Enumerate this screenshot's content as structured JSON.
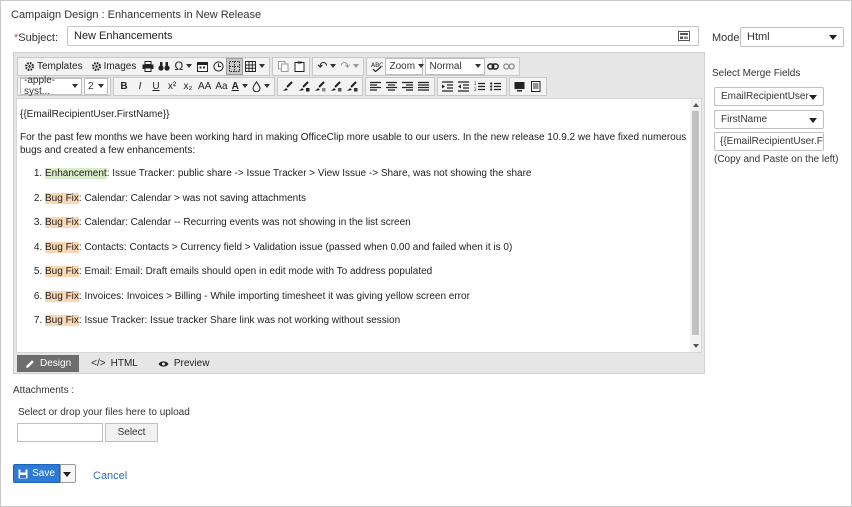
{
  "page": {
    "title": "Campaign Design : Enhancements in New Release"
  },
  "subject": {
    "required_mark": "*",
    "label": "Subject:",
    "value": "New Enhancements"
  },
  "mode": {
    "label": "Mode:",
    "value": "Html"
  },
  "toolbar": {
    "templates": "Templates",
    "images": "Images",
    "zoom": "Zoom",
    "format": "Normal",
    "font": "-apple-syst...",
    "size": "2",
    "bold": "B",
    "italic": "I",
    "underline": "U",
    "superscript": "x²",
    "subscript": "x₂",
    "grow_font": "AA",
    "shrink_font": "Aa",
    "font_color": "A"
  },
  "content": {
    "greeting": "{{EmailRecipientUser.FirstName}}",
    "intro": "For the past few months we have been working hard in making OfficeClip more usable to our users. In the new release 10.9.2 we have fixed numerous bugs and created a few enhancements:",
    "items": [
      {
        "tag": "Enhancement",
        "text": ": Issue Tracker: public share -> Issue Tracker > View Issue -> Share, was not showing the share"
      },
      {
        "tag": "Bug Fix",
        "text": ": Calendar: Calendar > was not saving attachments"
      },
      {
        "tag": "Bug Fix",
        "text": ": Calendar: Calendar -- Recurring events was not showing in the list screen"
      },
      {
        "tag": "Bug Fix",
        "text": ": Contacts: Contacts > Currency field > Validation issue (passed when 0.00 and failed when it is 0)"
      },
      {
        "tag": "Bug Fix",
        "text": ": Email: Email: Draft emails should open in edit mode with To address populated"
      },
      {
        "tag": "Bug Fix",
        "text": ": Invoices: Invoices > Billing - While importing timesheet it was giving yellow screen error"
      },
      {
        "tag": "Bug Fix",
        "text": ": Issue Tracker: Issue tracker Share link was not working without session"
      }
    ]
  },
  "mode_tabs": {
    "design": "Design",
    "html": "HTML",
    "preview": "Preview"
  },
  "merge": {
    "label": "Select Merge Fields",
    "object": "EmailRecipientUser",
    "field": "FirstName",
    "token": "{{EmailRecipientUser.First",
    "hint": "(Copy and Paste on the left)"
  },
  "attachments": {
    "label": "Attachments :",
    "drop_label": "Select or drop your files here to upload",
    "select_button": "Select"
  },
  "actions": {
    "save": "Save",
    "cancel": "Cancel"
  },
  "colors": {
    "save": "#2d7bd6",
    "link": "#2d6fbf",
    "enhancement_highlight": "#d8ecc8",
    "bugfix_highlight": "#f9d7b5",
    "required": "#d9534f"
  }
}
